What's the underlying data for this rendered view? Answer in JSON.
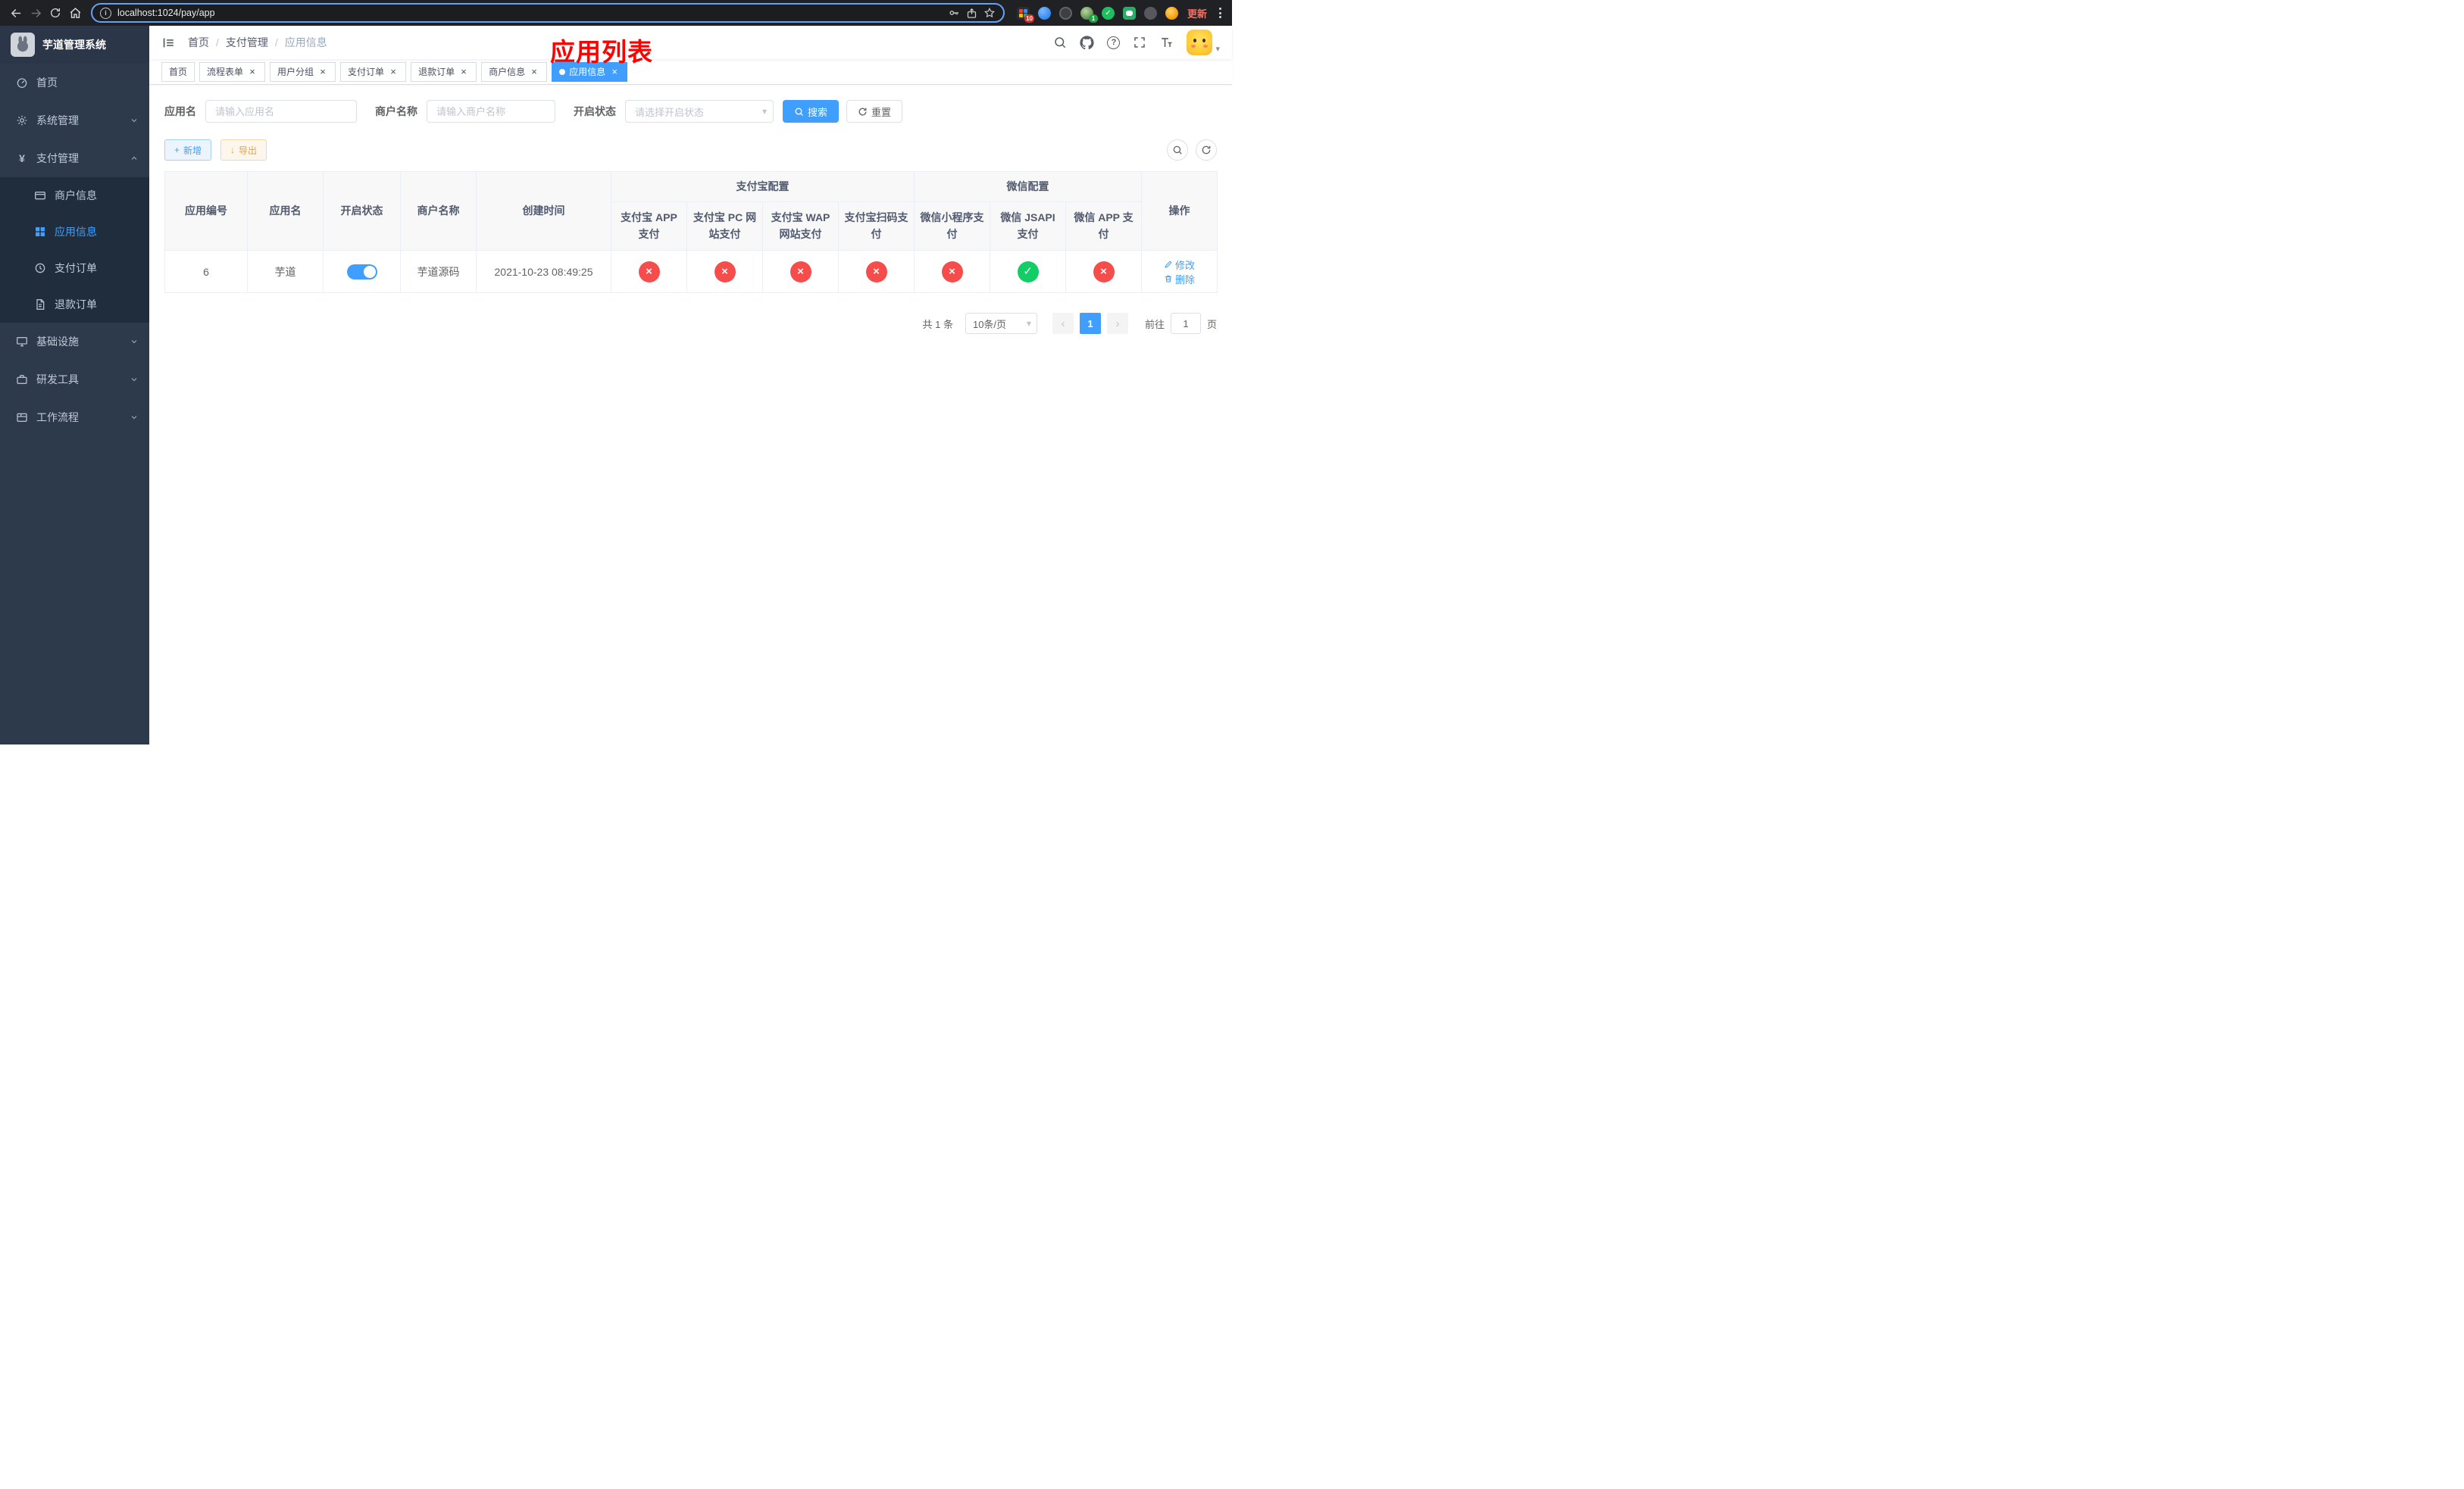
{
  "browser": {
    "url": "localhost:1024/pay/app",
    "update_label": "更新",
    "ext_badge_red": "10",
    "ext_badge_green": "1"
  },
  "annotation": {
    "text": "应用列表",
    "color": "#ff0000"
  },
  "sidebar": {
    "app_title": "芋道管理系统",
    "items": [
      {
        "label": "首页"
      },
      {
        "label": "系统管理"
      },
      {
        "label": "支付管理"
      },
      {
        "label": "基础设施"
      },
      {
        "label": "研发工具"
      },
      {
        "label": "工作流程"
      }
    ],
    "submenu": [
      {
        "label": "商户信息"
      },
      {
        "label": "应用信息"
      },
      {
        "label": "支付订单"
      },
      {
        "label": "退款订单"
      }
    ]
  },
  "header": {
    "breadcrumb": [
      {
        "label": "首页"
      },
      {
        "label": "支付管理"
      },
      {
        "label": "应用信息"
      }
    ]
  },
  "tabs": [
    {
      "label": "首页"
    },
    {
      "label": "流程表单"
    },
    {
      "label": "用户分组"
    },
    {
      "label": "支付订单"
    },
    {
      "label": "退款订单"
    },
    {
      "label": "商户信息"
    },
    {
      "label": "应用信息"
    }
  ],
  "filters": {
    "app_name_label": "应用名",
    "app_name_placeholder": "请输入应用名",
    "merchant_label": "商户名称",
    "merchant_placeholder": "请输入商户名称",
    "status_label": "开启状态",
    "status_placeholder": "请选择开启状态",
    "search_label": "搜索",
    "reset_label": "重置"
  },
  "toolbar": {
    "add_label": "新增",
    "export_label": "导出"
  },
  "table": {
    "headers": {
      "app_id": "应用编号",
      "app_name": "应用名",
      "status": "开启状态",
      "merchant": "商户名称",
      "created": "创建时间",
      "alipay_group": "支付宝配置",
      "wechat_group": "微信配置",
      "alipay_app": "支付宝 APP 支付",
      "alipay_pc": "支付宝 PC 网站支付",
      "alipay_wap": "支付宝 WAP 网站支付",
      "alipay_qr": "支付宝扫码支付",
      "wx_lite": "微信小程序支付",
      "wx_jsapi": "微信 JSAPI 支付",
      "wx_app": "微信 APP 支付",
      "actions": "操作"
    },
    "row": {
      "app_id": "6",
      "app_name": "芋道",
      "status_on": true,
      "merchant": "芋道源码",
      "created": "2021-10-23 08:49:25",
      "alipay_app": false,
      "alipay_pc": false,
      "alipay_wap": false,
      "alipay_qr": false,
      "wx_lite": false,
      "wx_jsapi": true,
      "wx_app": false,
      "edit_label": "修改",
      "delete_label": "删除"
    }
  },
  "pagination": {
    "total": "共 1 条",
    "page_size": "10条/页",
    "page": "1",
    "goto_label": "前往",
    "goto_value": "1",
    "unit_label": "页"
  },
  "glyphs": {
    "close": "×",
    "cross": "×",
    "check": "✓",
    "caret": "▾",
    "prev": "‹",
    "next": "›",
    "yen": "¥",
    "plus": "+",
    "download": "↓",
    "slash": "/",
    "question": "?",
    "info": "i"
  },
  "colors": {
    "primary": "#409eff",
    "success": "#13ce66",
    "danger": "#f64c4c",
    "warning": "#e6a23c",
    "annotation_red": "#ff0000",
    "sidebar_bg": "#2d3a4b",
    "submenu_bg": "#1f2d3d",
    "chrome_bg": "#202124",
    "omnibox_focus_border": "#67a1f7"
  }
}
